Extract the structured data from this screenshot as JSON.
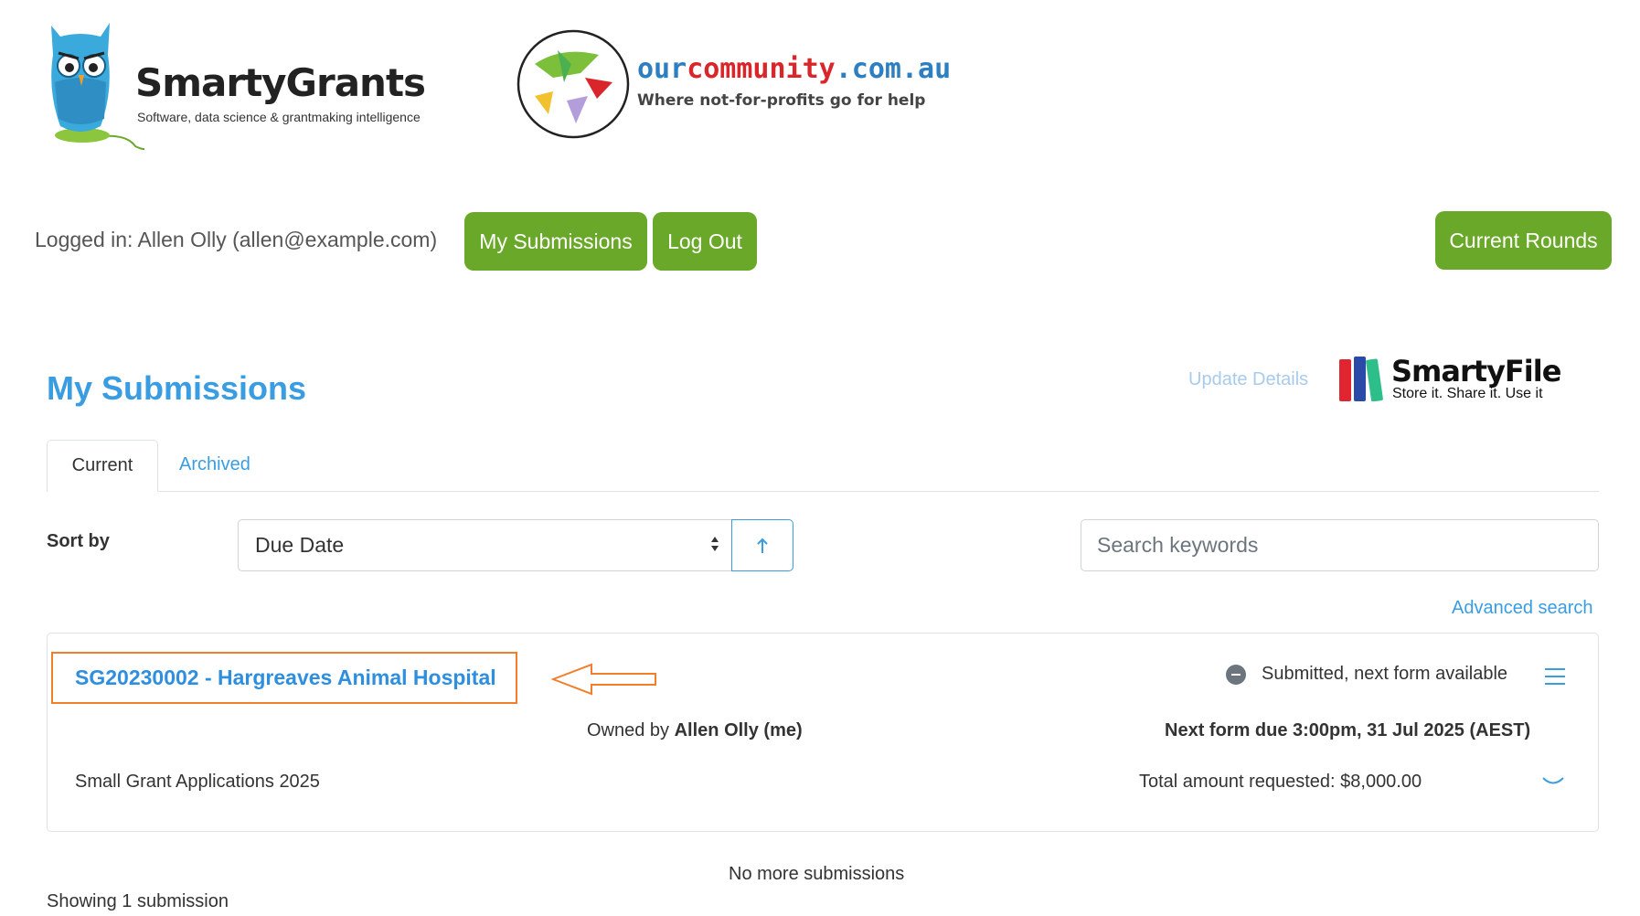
{
  "header": {
    "smartygrants": {
      "name": "SmartyGrants",
      "tagline": "Software, data science & grantmaking intelligence"
    },
    "ourcommunity": {
      "name_part1": "our",
      "name_part2": "community",
      "name_part3": ".com.au",
      "tagline": "Where not-for-profits go for help"
    }
  },
  "topbar": {
    "logged_in": "Logged in: Allen Olly (allen@example.com)",
    "my_submissions_label": "My Submissions",
    "logout_label": "Log Out",
    "current_rounds_label": "Current Rounds"
  },
  "page": {
    "title": "My Submissions",
    "update_details": "Update Details",
    "smartyfile": {
      "name": "SmartyFile",
      "tagline": "Store it. Share it. Use it"
    }
  },
  "tabs": [
    {
      "label": "Current",
      "active": true
    },
    {
      "label": "Archived",
      "active": false
    }
  ],
  "sort": {
    "label": "Sort by",
    "selected": "Due Date",
    "direction_icon": "arrow-up"
  },
  "search": {
    "placeholder": "Search keywords",
    "advanced_label": "Advanced search"
  },
  "submission": {
    "title": "SG20230002 - Hargreaves Animal Hospital",
    "status": "Submitted, next form available",
    "owned_prefix": "Owned by ",
    "owner": "Allen Olly (me)",
    "next_due": "Next form due 3:00pm, 31 Jul 2025  (AEST)",
    "round": "Small Grant Applications 2025",
    "total": "Total amount requested: $8,000.00"
  },
  "footer": {
    "no_more": "No more submissions",
    "showing": "Showing 1 submission"
  },
  "colors": {
    "green": "#6aa829",
    "blue": "#3a9de2",
    "annotation_orange": "#f07e2a"
  }
}
